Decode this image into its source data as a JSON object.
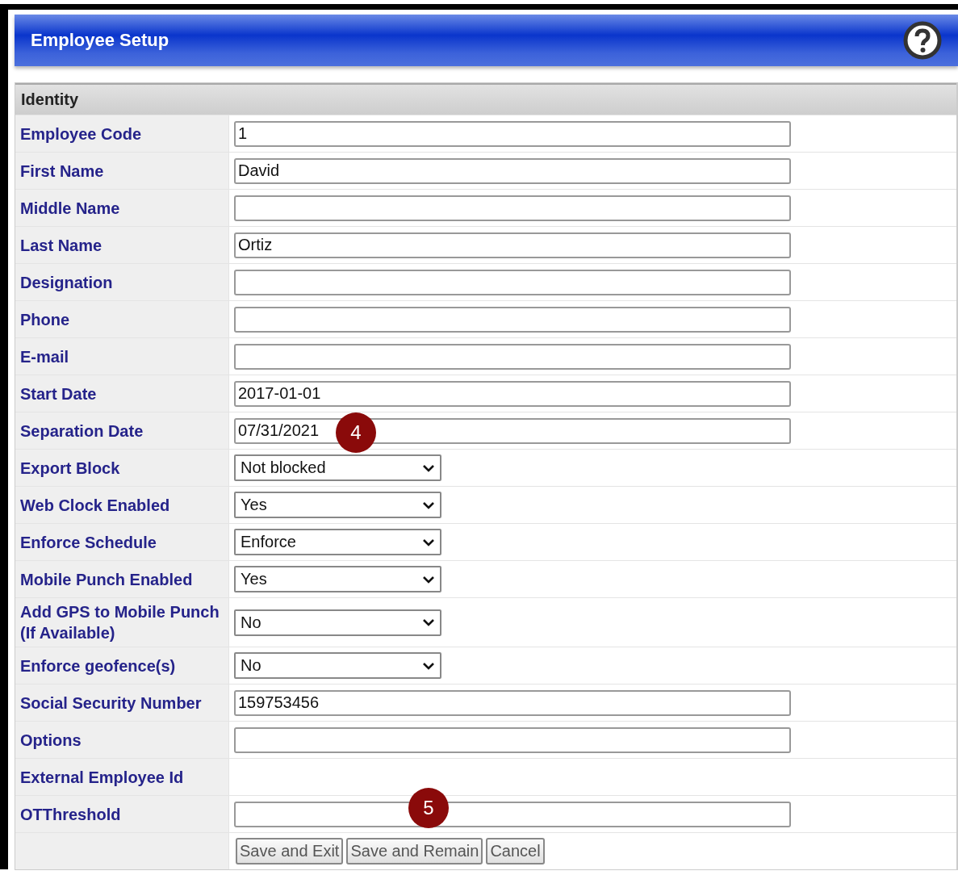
{
  "header": {
    "title": "Employee Setup"
  },
  "section": {
    "title": "Identity"
  },
  "rows": [
    {
      "label": "Employee Code",
      "kind": "text",
      "value": "1"
    },
    {
      "label": "First Name",
      "kind": "text",
      "value": "David"
    },
    {
      "label": "Middle Name",
      "kind": "text"
    },
    {
      "label": "Last Name",
      "kind": "text",
      "value": "Ortiz"
    },
    {
      "label": "Designation",
      "kind": "text"
    },
    {
      "label": "Phone",
      "kind": "text"
    },
    {
      "label": "E-mail",
      "kind": "text"
    },
    {
      "label": "Start Date",
      "kind": "text",
      "value": "2017-01-01"
    },
    {
      "label": "Separation Date",
      "kind": "text",
      "value": "07/31/2021",
      "callout": "4"
    },
    {
      "label": "Export Block",
      "kind": "select",
      "value": "Not blocked"
    },
    {
      "label": "Web Clock Enabled",
      "kind": "select",
      "value": "Yes"
    },
    {
      "label": "Enforce Schedule",
      "kind": "select",
      "value": "Enforce"
    },
    {
      "label": "Mobile Punch Enabled",
      "kind": "select",
      "value": "Yes"
    },
    {
      "label": "Add GPS to Mobile Punch (If Available)",
      "kind": "select",
      "value": "No"
    },
    {
      "label": "Enforce geofence(s)",
      "kind": "select",
      "value": "No"
    },
    {
      "label": "Social Security Number",
      "kind": "text",
      "value": "159753456"
    },
    {
      "label": "Options",
      "kind": "text"
    },
    {
      "label": "External Employee Id",
      "kind": "static"
    },
    {
      "label": "OTThreshold",
      "kind": "text",
      "callout": "5"
    }
  ],
  "buttons": [
    "Save and Exit",
    "Save and Remain",
    "Cancel"
  ]
}
